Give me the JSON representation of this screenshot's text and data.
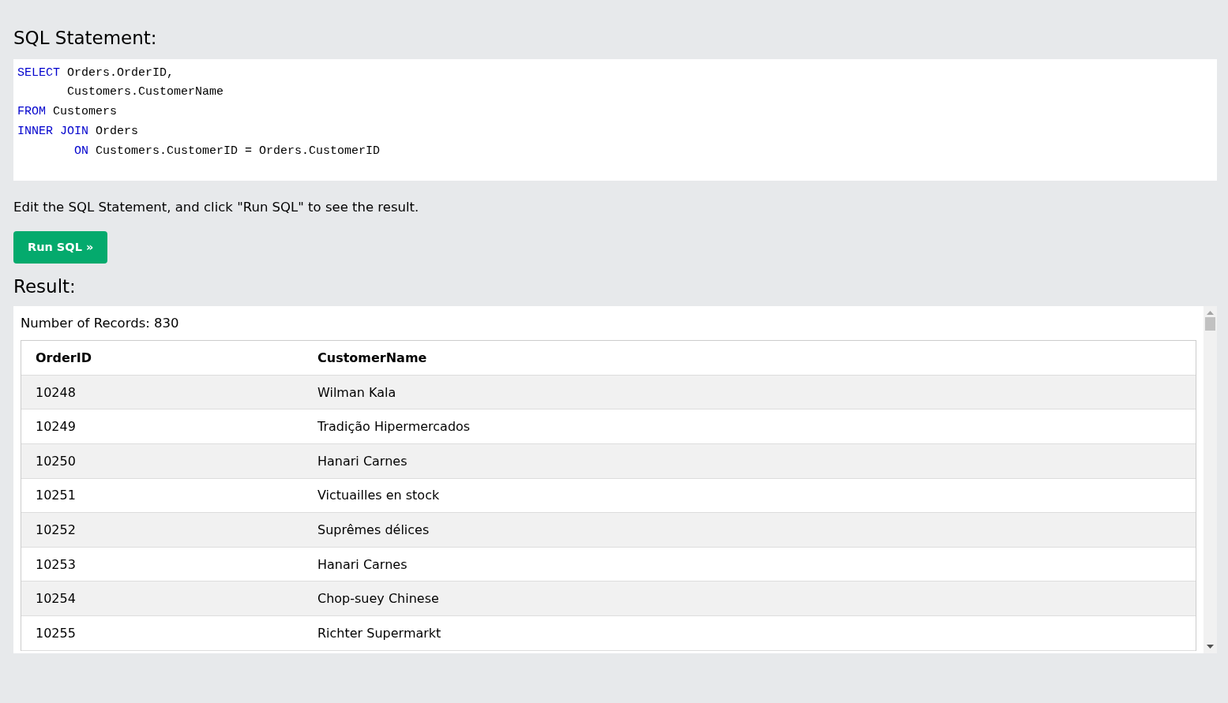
{
  "sql_heading": "SQL Statement:",
  "sql_lines": [
    {
      "tokens": [
        {
          "kind": "keyword",
          "text": "SELECT"
        },
        {
          "kind": "plain",
          "text": " Orders.OrderID,"
        }
      ]
    },
    {
      "tokens": [
        {
          "kind": "plain",
          "text": "       Customers.CustomerName"
        }
      ]
    },
    {
      "tokens": [
        {
          "kind": "keyword",
          "text": "FROM"
        },
        {
          "kind": "plain",
          "text": " Customers"
        }
      ]
    },
    {
      "tokens": [
        {
          "kind": "keyword",
          "text": "INNER JOIN"
        },
        {
          "kind": "plain",
          "text": " Orders"
        }
      ]
    },
    {
      "tokens": [
        {
          "kind": "keyword",
          "text": "        ON"
        },
        {
          "kind": "plain",
          "text": " Customers.CustomerID = Orders.CustomerID"
        }
      ]
    }
  ],
  "instruction": "Edit the SQL Statement, and click \"Run SQL\" to see the result.",
  "run_button": "Run SQL »",
  "result_heading": "Result:",
  "record_count": "Number of Records: 830",
  "table": {
    "columns": [
      "OrderID",
      "CustomerName"
    ],
    "rows": [
      [
        "10248",
        "Wilman Kala"
      ],
      [
        "10249",
        "Tradição Hipermercados"
      ],
      [
        "10250",
        "Hanari Carnes"
      ],
      [
        "10251",
        "Victuailles en stock"
      ],
      [
        "10252",
        "Suprêmes délices"
      ],
      [
        "10253",
        "Hanari Carnes"
      ],
      [
        "10254",
        "Chop-suey Chinese"
      ],
      [
        "10255",
        "Richter Supermarkt"
      ]
    ]
  }
}
